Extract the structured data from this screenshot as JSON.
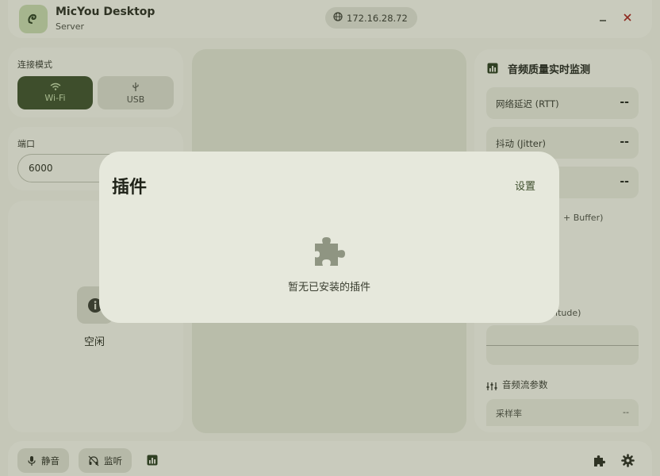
{
  "header": {
    "title": "MicYou Desktop",
    "subtitle": "Server",
    "ip_address": "172.16.28.72"
  },
  "connection_mode": {
    "label": "连接模式",
    "options": [
      {
        "label": "Wi-Fi",
        "selected": true
      },
      {
        "label": "USB",
        "selected": false
      }
    ]
  },
  "port": {
    "label": "端口",
    "value": "6000"
  },
  "status": {
    "text": "空闲"
  },
  "monitor": {
    "title": "音频质量实时监测",
    "metrics": [
      {
        "label": "网络延迟 (RTT)",
        "value": "--"
      },
      {
        "label": "抖动 (Jitter)",
        "value": "--"
      },
      {
        "label": "",
        "value": "--"
      }
    ],
    "buffer_hint": "+ Buffer)",
    "amplitude_hint": "plitude)",
    "stream_params_title": "音频流参数",
    "sample_rate_label": "采样率",
    "sample_rate_value": "--"
  },
  "bottom_bar": {
    "mute_label": "静音",
    "monitor_label": "监听"
  },
  "plugins_dialog": {
    "title": "插件",
    "settings_label": "设置",
    "empty_message": "暂无已安装的插件"
  },
  "colors": {
    "accent_dark": "#3e4e2c",
    "accent_light": "#a7b98e",
    "close_red": "#8e2a20",
    "dialog_bg": "#e6e8dc"
  }
}
